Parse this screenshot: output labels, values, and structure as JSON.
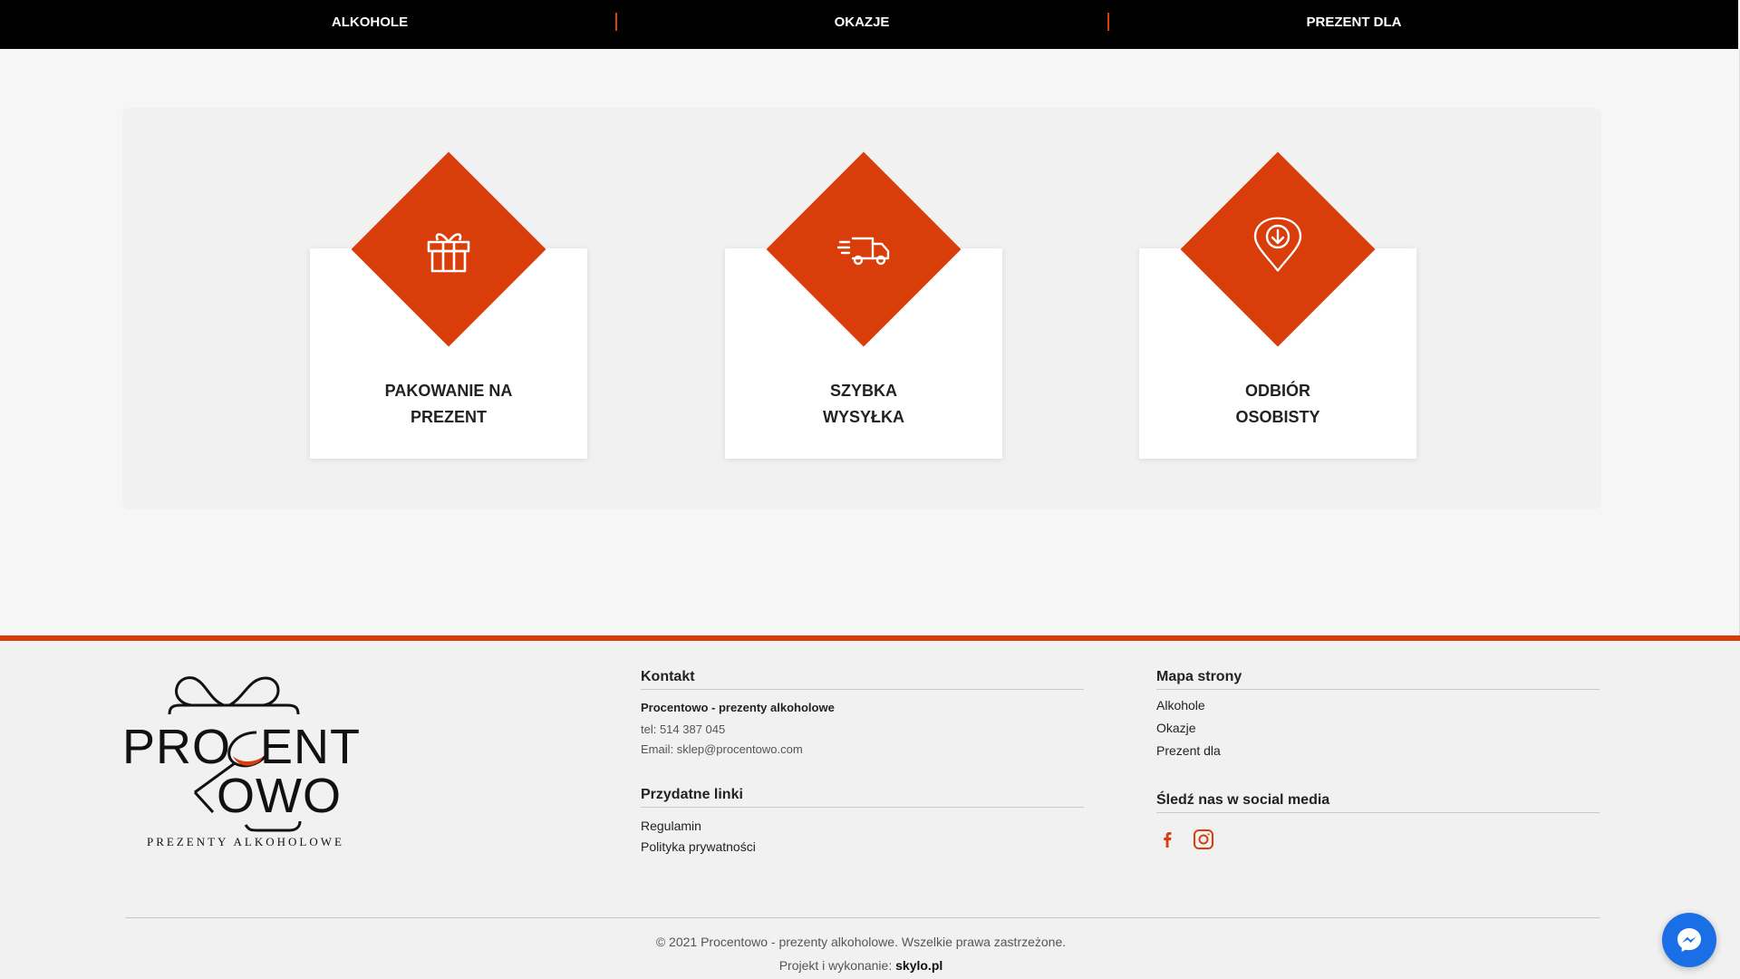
{
  "nav": {
    "items": [
      {
        "label": "ALKOHOLE"
      },
      {
        "label": "OKAZJE"
      },
      {
        "label": "PREZENT DLA"
      }
    ]
  },
  "features": [
    {
      "title_line1": "PAKOWANIE NA",
      "title_line2": "PREZENT",
      "icon": "gift-icon"
    },
    {
      "title_line1": "SZYBKA",
      "title_line2": "WYSYŁKA",
      "icon": "delivery-truck-icon"
    },
    {
      "title_line1": "ODBIÓR",
      "title_line2": "OSOBISTY",
      "icon": "location-pin-icon"
    }
  ],
  "logo": {
    "line1": "PROCENT",
    "line2": "OWO",
    "tagline": "PREZENTY ALKOHOLOWE"
  },
  "contact": {
    "heading": "Kontakt",
    "company": "Procentowo - prezenty alkoholowe",
    "phone": "tel: 514 387 045",
    "email": "Email: sklep@procentowo.com"
  },
  "useful_links": {
    "heading": "Przydatne linki",
    "items": [
      "Regulamin",
      "Polityka prywatności"
    ]
  },
  "sitemap": {
    "heading": "Mapa strony",
    "items": [
      "Alkohole",
      "Okazje",
      "Prezent dla"
    ]
  },
  "social": {
    "heading": "Śledź nas w social media",
    "icons": [
      "facebook-icon",
      "instagram-icon"
    ]
  },
  "footer": {
    "copyright": "© 2021 Procentowo - prezenty alkoholowe. Wszelkie prawa zastrzeżone.",
    "credit_prefix": "Projekt i wykonanie:",
    "credit_brand": "skylo.pl"
  },
  "colors": {
    "accent": "#d93e0a",
    "nav_bg": "#000000",
    "messenger": "#1a6fe6"
  }
}
